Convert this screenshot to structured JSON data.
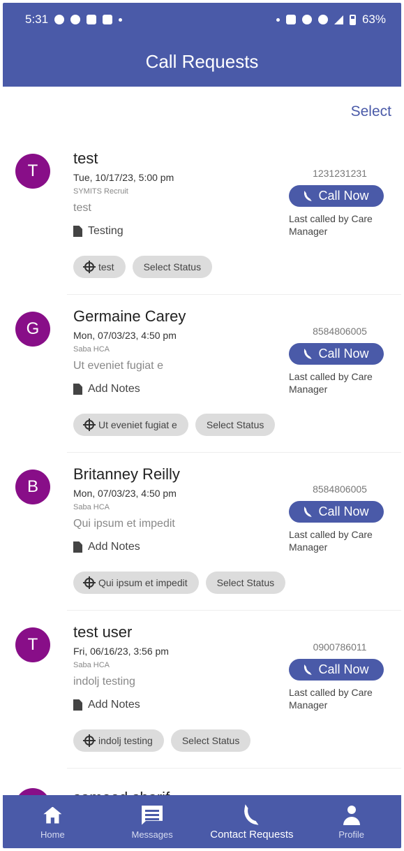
{
  "statusbar": {
    "time": "5:31",
    "battery": "63%"
  },
  "appbar": {
    "title": "Call Requests"
  },
  "select_label": "Select",
  "requests": [
    {
      "initial": "T",
      "name": "test",
      "date": "Tue, 10/17/23, 5:00 pm",
      "org": "SYMITS Recruit",
      "message": "test",
      "notes": "Testing",
      "reason_chip": "test",
      "status_chip": "Select Status",
      "phone": "1231231231",
      "call_label": "Call Now",
      "last_called": "Last called by Care Manager"
    },
    {
      "initial": "G",
      "name": "Germaine Carey",
      "date": "Mon, 07/03/23, 4:50 pm",
      "org": "Saba HCA",
      "message": "Ut eveniet fugiat e",
      "notes": "Add Notes",
      "reason_chip": "Ut eveniet fugiat e",
      "status_chip": "Select Status",
      "phone": "8584806005",
      "call_label": "Call Now",
      "last_called": "Last called by Care Manager"
    },
    {
      "initial": "B",
      "name": "Britanney Reilly",
      "date": "Mon, 07/03/23, 4:50 pm",
      "org": "Saba HCA",
      "message": "Qui ipsum et impedit",
      "notes": "Add Notes",
      "reason_chip": "Qui ipsum et impedit",
      "status_chip": "Select Status",
      "phone": "8584806005",
      "call_label": "Call Now",
      "last_called": "Last called by Care Manager"
    },
    {
      "initial": "T",
      "name": "test user",
      "date": "Fri, 06/16/23, 3:56 pm",
      "org": "Saba HCA",
      "message": "indolj testing",
      "notes": "Add Notes",
      "reason_chip": "indolj testing",
      "status_chip": "Select Status",
      "phone": "0900786011",
      "call_label": "Call Now",
      "last_called": "Last called by Care Manager"
    }
  ],
  "partial_item": {
    "name": "sameed sharif"
  },
  "nav": {
    "home": "Home",
    "messages": "Messages",
    "contact_requests": "Contact Requests",
    "profile": "Profile"
  },
  "colors": {
    "primary": "#4a5aa8",
    "avatar": "#880e88",
    "chip": "#dcdcdc"
  }
}
